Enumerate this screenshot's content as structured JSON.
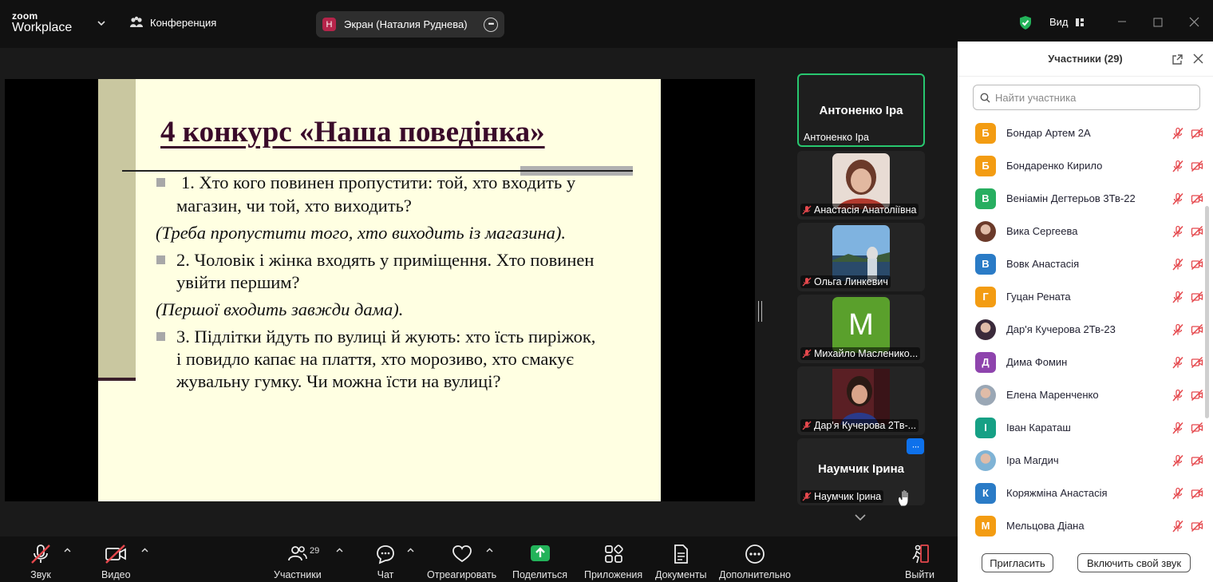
{
  "app": {
    "brand_top": "zoom",
    "brand_bottom": "Workplace",
    "meeting_label": "Конференция",
    "share_pill": "Экран (Наталия Руднева)",
    "share_pill_avatar": "Н",
    "view_label": "Вид"
  },
  "slide": {
    "title": "4 конкурс  «Наша поведінка»",
    "q1_line1": "1. Хто кого повинен пропустити: той, хто входить у",
    "q1_line2": "магазин, чи той, хто виходить?",
    "a1": "(Треба пропустити того, хто виходить із магазина).",
    "q2_line1": "2. Чоловік і жінка входять у приміщення. Хто повинен",
    "q2_line2": "увійти першим?",
    "a2": "(Першої входить завжди дама).",
    "q3_line1": "3. Підлітки йдуть по вулиці й жують: хто їсть пиріжок,",
    "q3_line2": "і повидло капає на плаття, хто морозиво, хто смакує",
    "q3_line3": "жувальну гумку. Чи можна їсти на вулиці?"
  },
  "videos": {
    "active_big": "Антоненко Іра",
    "active_label": "Антоненко Іра",
    "tiles": [
      "Анастасія Анатоліївна",
      "Ольга Линкевич",
      "Михайло Масленико...",
      "Дар'я Кучерова 2Тв-..."
    ],
    "tile_m_letter": "M",
    "more_dots": "···",
    "last_big": "Наумчик Ірина",
    "last_label": "Наумчик Ірина"
  },
  "toolbar": {
    "audio": "Звук",
    "video": "Видео",
    "participants": "Участники",
    "participants_count": "29",
    "chat": "Чат",
    "react": "Отреагировать",
    "share": "Поделиться",
    "apps": "Приложения",
    "docs": "Документы",
    "more": "Дополнительно",
    "leave": "Выйти"
  },
  "panel": {
    "title": "Участники (29)",
    "search_placeholder": "Найти участника",
    "participants": [
      {
        "initial": "Б",
        "name": "Бондар Артем 2А",
        "color": "#f39c12"
      },
      {
        "initial": "Б",
        "name": "Бондаренко Кирило",
        "color": "#f39c12"
      },
      {
        "initial": "В",
        "name": "Веніамін Дегтерьов 3Тв-22",
        "color": "#27ae60"
      },
      {
        "initial": "",
        "name": "Вика Сергеева",
        "color": "#6b3a2a"
      },
      {
        "initial": "В",
        "name": "Вовк Анастасія",
        "color": "#2a7bc6"
      },
      {
        "initial": "Г",
        "name": "Гуцан Рената",
        "color": "#f39c12"
      },
      {
        "initial": "",
        "name": "Дар'я Кучерова 2Тв-23",
        "color": "#3a2a3a"
      },
      {
        "initial": "Д",
        "name": "Дима Фомин",
        "color": "#8e44ad"
      },
      {
        "initial": "",
        "name": "Елена Маренченко",
        "color": "#9aa7b5"
      },
      {
        "initial": "І",
        "name": "Іван Караташ",
        "color": "#16a085"
      },
      {
        "initial": "",
        "name": "Іра Магдич",
        "color": "#7fb3d5"
      },
      {
        "initial": "К",
        "name": "Коряжміна Анастасія",
        "color": "#2a7bc6"
      },
      {
        "initial": "М",
        "name": "Мельцова Діана",
        "color": "#f39c12"
      }
    ],
    "invite": "Пригласить",
    "unmute": "Включить свой звук"
  }
}
